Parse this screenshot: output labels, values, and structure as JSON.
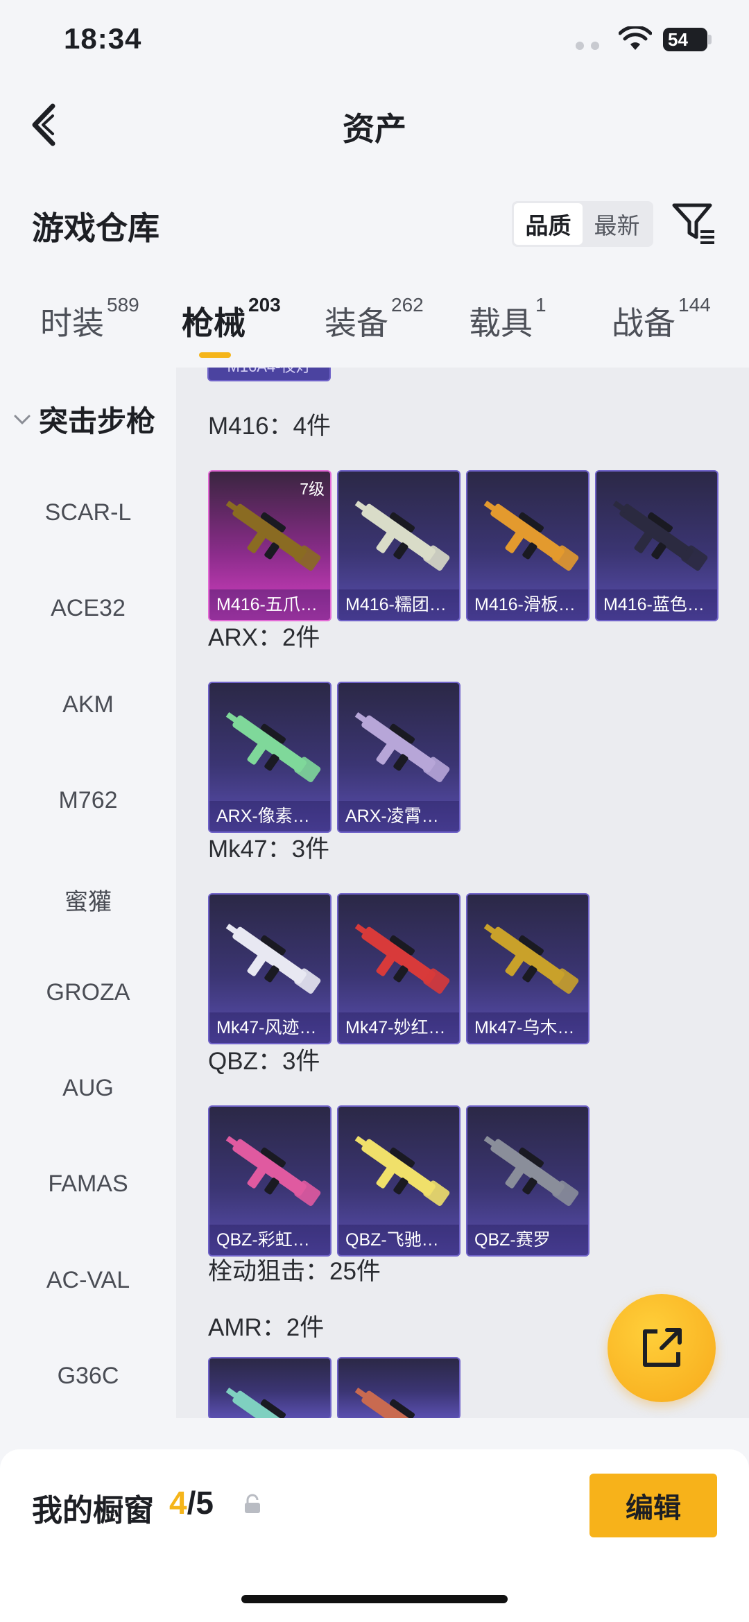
{
  "status_bar": {
    "time": "18:34",
    "battery": "54"
  },
  "header": {
    "title": "资产"
  },
  "section": {
    "title": "游戏仓库"
  },
  "sort": {
    "options": [
      "品质",
      "最新"
    ],
    "selected": "品质"
  },
  "tabs": [
    {
      "label": "时装",
      "count": "589"
    },
    {
      "label": "枪械",
      "count": "203"
    },
    {
      "label": "装备",
      "count": "262"
    },
    {
      "label": "载具",
      "count": "1"
    },
    {
      "label": "战备",
      "count": "144"
    }
  ],
  "active_tab": "枪械",
  "sidebar": {
    "header": "突击步枪",
    "items": [
      "SCAR-L",
      "ACE32",
      "AKM",
      "M762",
      "蜜獾",
      "GROZA",
      "AUG",
      "FAMAS",
      "AC-VAL",
      "G36C"
    ]
  },
  "content": {
    "partial_top_label": "M16A4-夜灯",
    "groups": [
      {
        "label": "M416：4件",
        "items": [
          {
            "name": "M416-五爪…",
            "level": "7级",
            "rarity": "legend",
            "gun_color": "#8a6b22"
          },
          {
            "name": "M416-糯团…",
            "rarity": "epic",
            "gun_color": "#d9dcc8"
          },
          {
            "name": "M416-滑板…",
            "rarity": "epic",
            "gun_color": "#e39a2e"
          },
          {
            "name": "M416-蓝色…",
            "rarity": "epic",
            "gun_color": "#2b2a40"
          }
        ]
      },
      {
        "label": "ARX：2件",
        "items": [
          {
            "name": "ARX-像素花束",
            "rarity": "epic",
            "gun_color": "#7fd89a"
          },
          {
            "name": "ARX-凌霄紫焰",
            "rarity": "epic",
            "gun_color": "#b7a6d8"
          }
        ]
      },
      {
        "label": "Mk47：3件",
        "items": [
          {
            "name": "Mk47-风迹…",
            "rarity": "epic",
            "gun_color": "#e8e8f2"
          },
          {
            "name": "Mk47-妙红…",
            "rarity": "epic",
            "gun_color": "#d83a3a"
          },
          {
            "name": "Mk47-乌木…",
            "rarity": "epic",
            "gun_color": "#c9a12a"
          }
        ]
      },
      {
        "label": "QBZ：3件",
        "items": [
          {
            "name": "QBZ-彩虹符号",
            "rarity": "epic",
            "gun_color": "#e05aa0"
          },
          {
            "name": "QBZ-飞驰魅影",
            "rarity": "epic",
            "gun_color": "#f0e06a"
          },
          {
            "name": "QBZ-赛罗",
            "rarity": "epic",
            "gun_color": "#8a8e9a"
          }
        ]
      }
    ],
    "sniper_label": "栓动狙击：25件",
    "amr_label": "AMR：2件",
    "amr_items": [
      {
        "rarity": "epic",
        "gun_color": "#7fd0c0"
      },
      {
        "rarity": "epic",
        "gun_color": "#c96a50"
      }
    ]
  },
  "showcase": {
    "label": "我的橱窗",
    "current": "4",
    "total": "/5",
    "edit_label": "编辑"
  },
  "colors": {
    "accent": "#f5b51a",
    "legend_card": "#d640c4",
    "epic_card": "#5a4fb0"
  }
}
